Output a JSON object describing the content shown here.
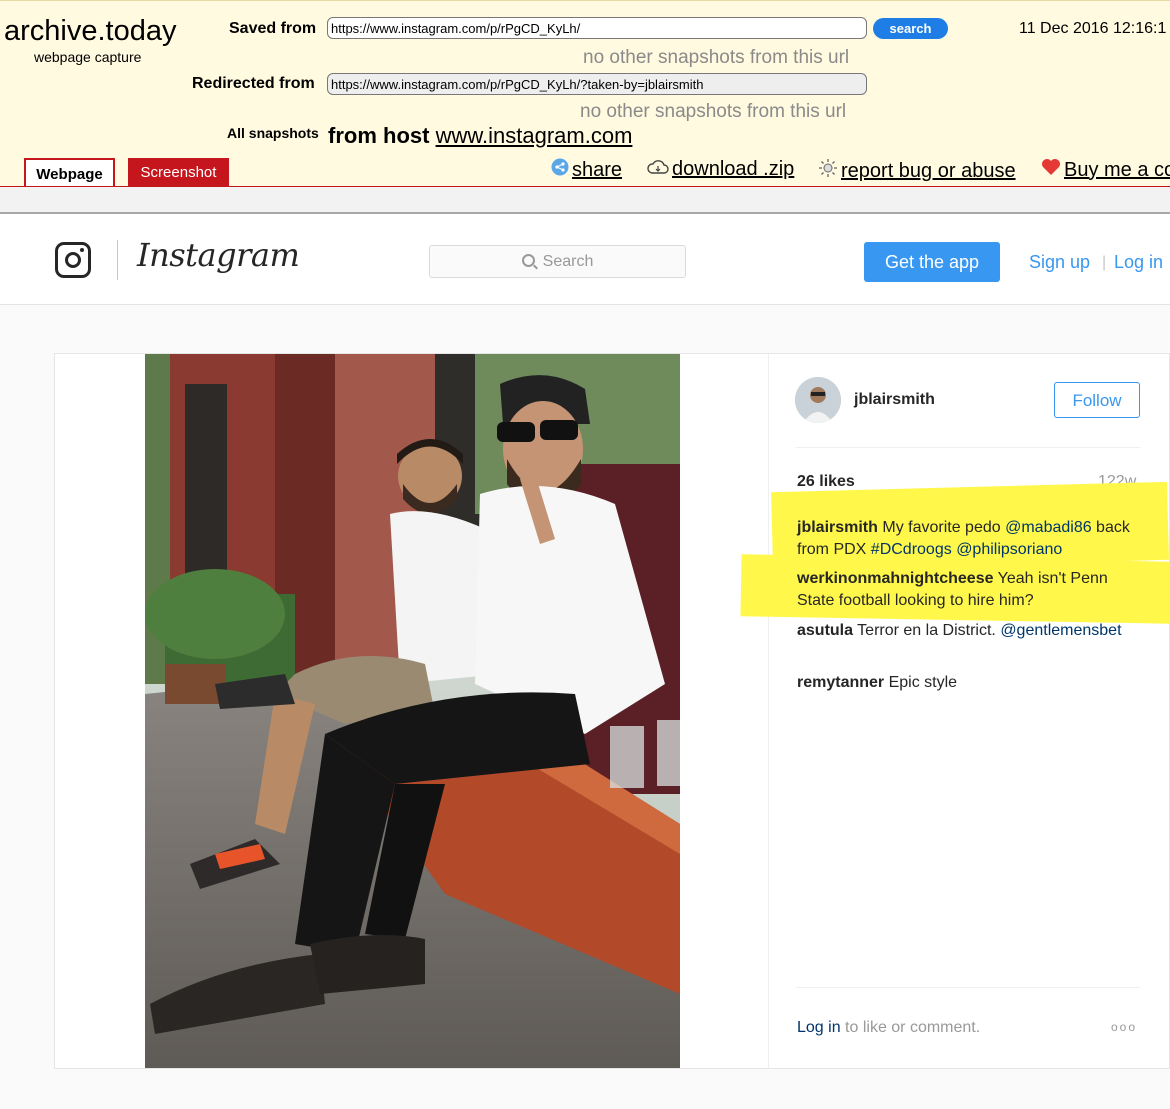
{
  "archive": {
    "logo": "archive.today",
    "subtitle": "webpage capture",
    "saved_from_label": "Saved from",
    "saved_url": "https://www.instagram.com/p/rPgCD_KyLh/",
    "search_label": "search",
    "date": "11 Dec 2016 12:16:1",
    "no_snapshots_1": "no other snapshots from this url",
    "redirected_label": "Redirected from",
    "redirected_url": "https://www.instagram.com/p/rPgCD_KyLh/?taken-by=jblairsmith",
    "no_snapshots_2": "no other snapshots from this url",
    "all_snapshots_label": "All snapshots",
    "from_host_label": "from host",
    "host": "www.instagram.com",
    "tab_webpage": "Webpage",
    "tab_screenshot": "Screenshot",
    "share": "share",
    "download": "download .zip",
    "report": "report bug or abuse",
    "buy": "Buy me a co",
    "colors": {
      "accent_red": "#c4161c",
      "search_blue": "#1e7ee6",
      "bg": "#fffae0"
    }
  },
  "instagram": {
    "wordmark": "Instagram",
    "search_placeholder": "Search",
    "get_app": "Get the app",
    "sign_up": "Sign up",
    "divider": "|",
    "log_in": "Log in",
    "colors": {
      "blue": "#3897f0",
      "link": "#003569"
    },
    "post": {
      "username": "jblairsmith",
      "follow": "Follow",
      "likes": "26 likes",
      "age": "122w",
      "comments": [
        {
          "user": "jblairsmith",
          "parts": [
            "My favorite pedo ",
            "@mabadi86",
            " back from PDX ",
            "#DCdroogs",
            " ",
            "@philipsoriano"
          ]
        },
        {
          "user": "werkinonmahnightcheese",
          "text": "Yeah isn't Penn State football looking to hire him?"
        },
        {
          "user": "asutula",
          "text": "Terror en la District. ",
          "mention": "@gentlemensbet"
        },
        {
          "user": "remytanner",
          "text": "Epic style"
        }
      ],
      "login_link": "Log in",
      "login_suffix": " to like or comment.",
      "more": "ooo"
    }
  }
}
